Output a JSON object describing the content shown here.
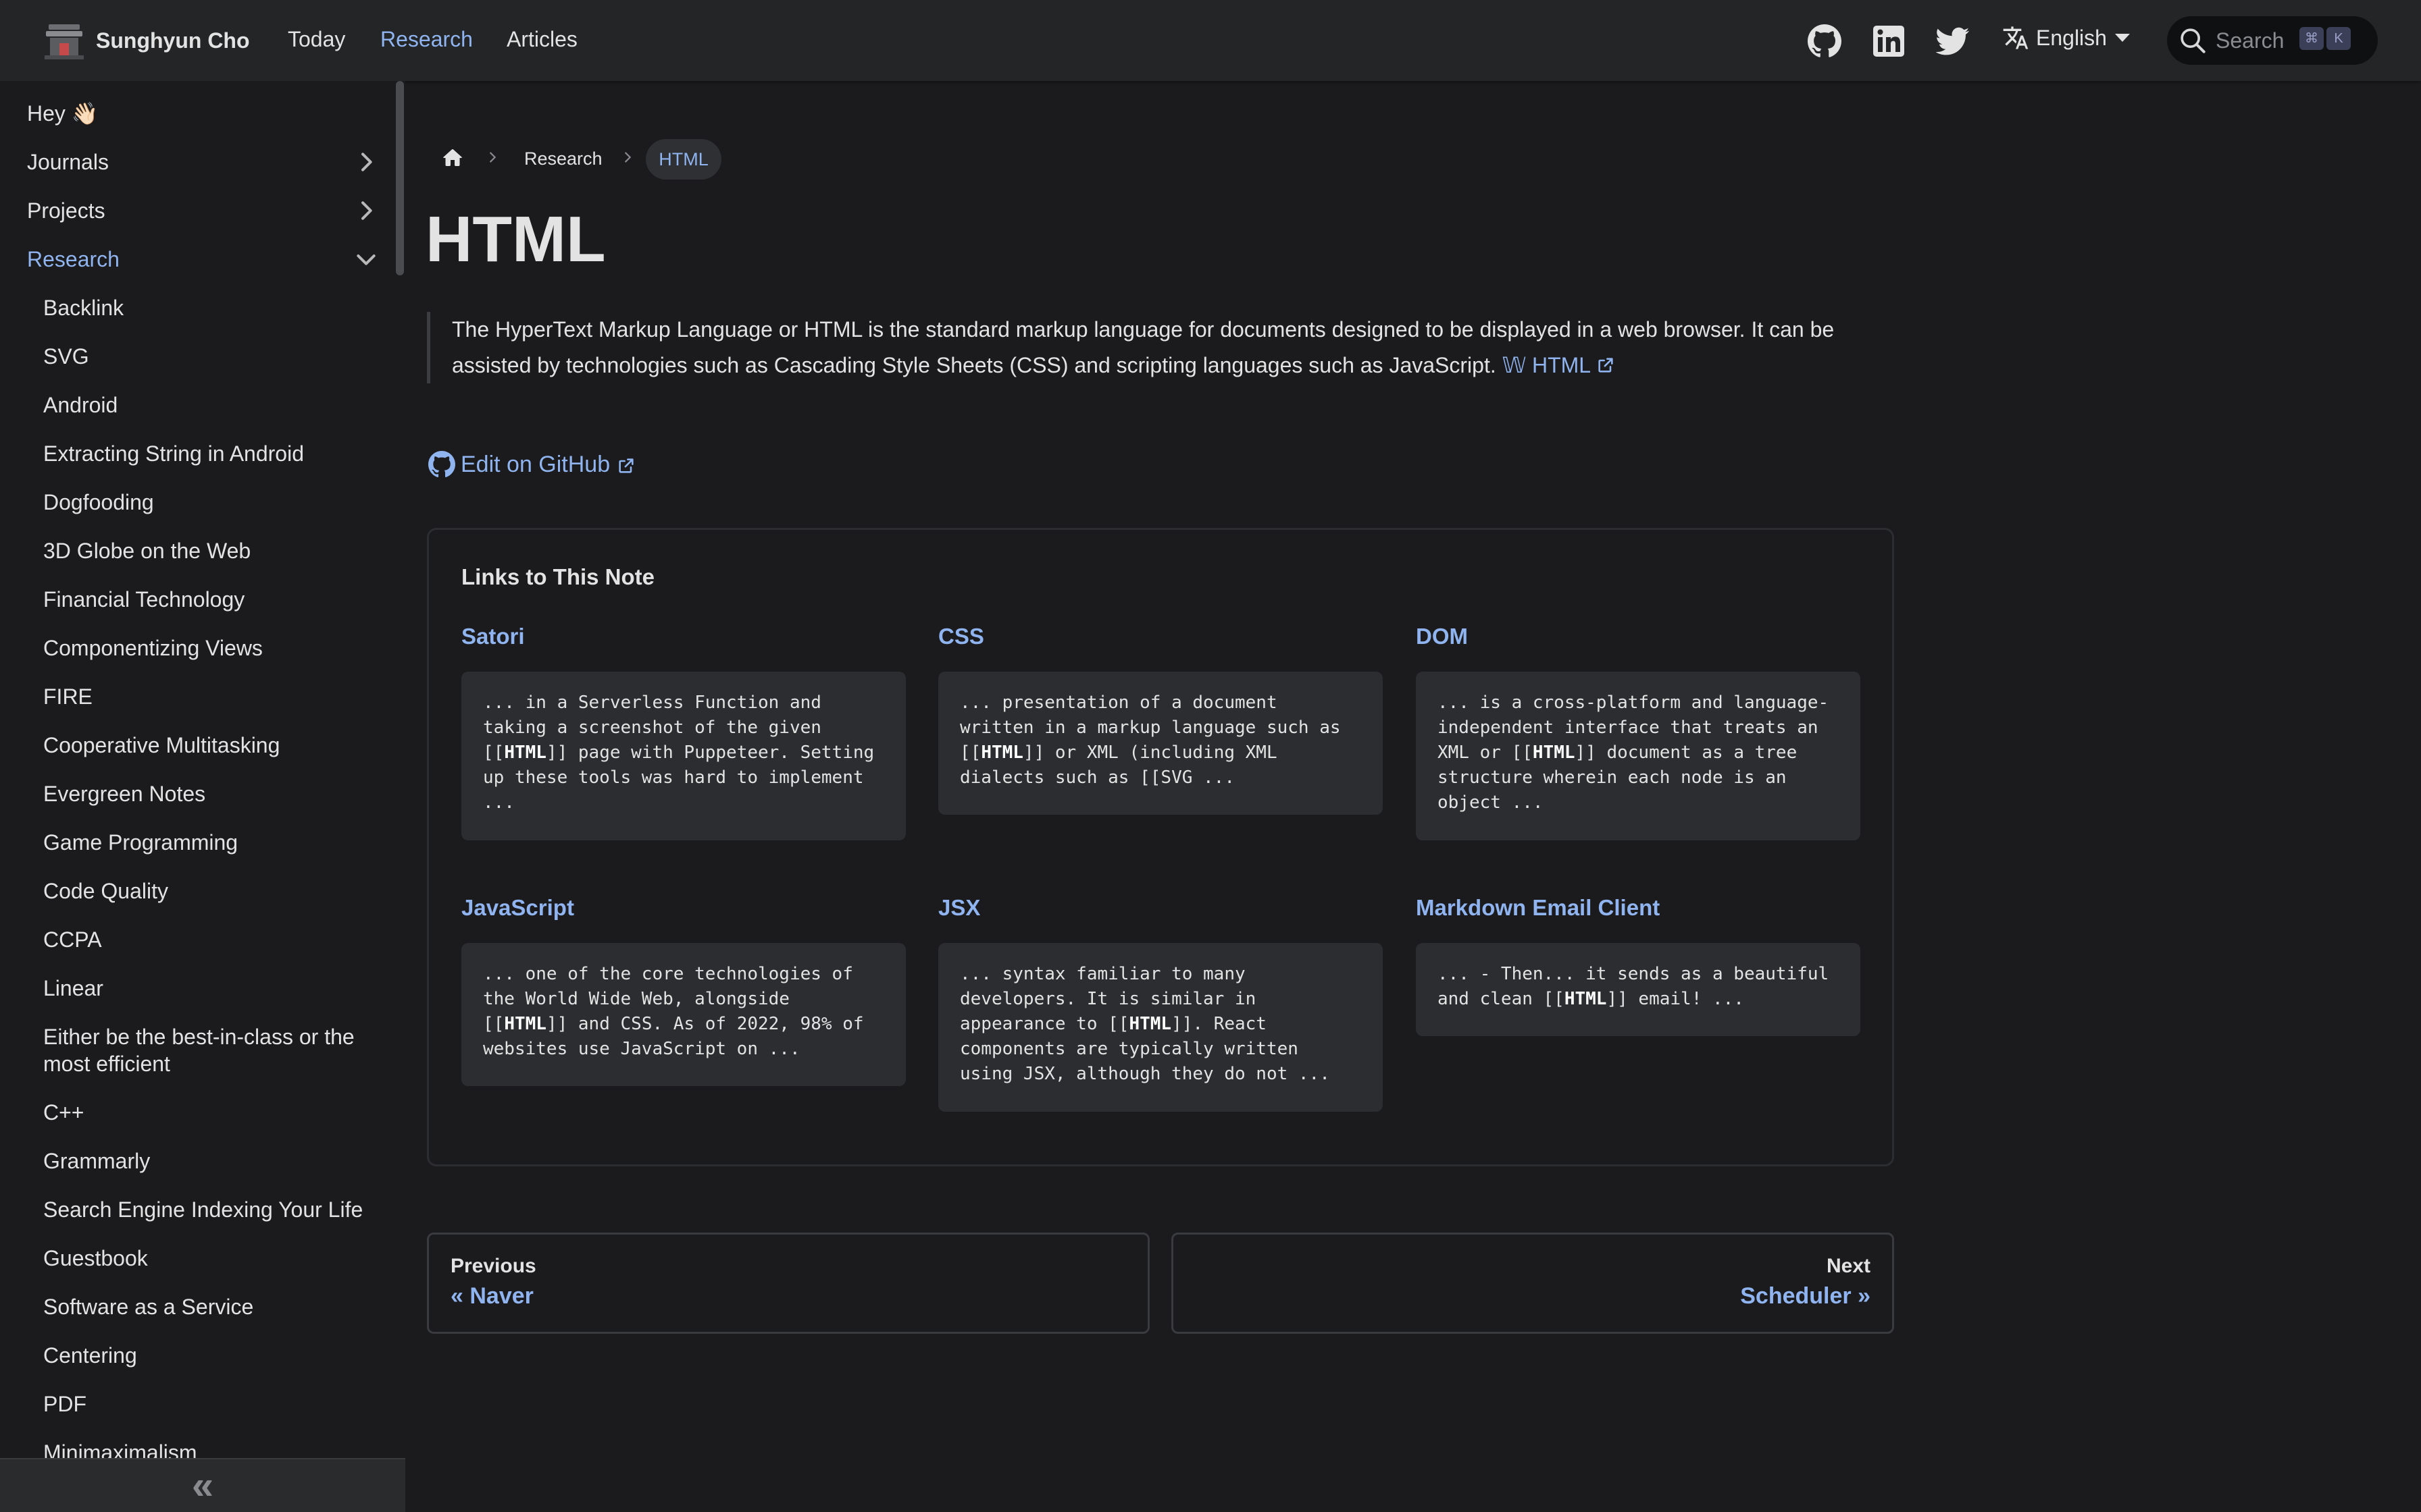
{
  "navbar": {
    "brand": "Sunghyun Cho",
    "links": [
      "Today",
      "Research",
      "Articles"
    ],
    "active_link": "Research",
    "icons": [
      "github-icon",
      "linkedin-icon",
      "twitter-icon"
    ],
    "language": "English",
    "search_placeholder": "Search",
    "search_keys": [
      "⌘",
      "K"
    ]
  },
  "sidebar": {
    "top_items": [
      {
        "label": "Hey 👋🏻",
        "chevron": "none"
      },
      {
        "label": "Journals",
        "chevron": "right"
      },
      {
        "label": "Projects",
        "chevron": "right"
      },
      {
        "label": "Research",
        "chevron": "down",
        "active": true
      }
    ],
    "research_items": [
      "Backlink",
      "SVG",
      "Android",
      "Extracting String in Android",
      "Dogfooding",
      "3D Globe on the Web",
      "Financial Technology",
      "Componentizing Views",
      "FIRE",
      "Cooperative Multitasking",
      "Evergreen Notes",
      "Game Programming",
      "Code Quality",
      "CCPA",
      "Linear",
      "Either be the best-in-class or the most efficient",
      "C++",
      "Grammarly",
      "Search Engine Indexing Your Life",
      "Guestbook",
      "Software as a Service",
      "Centering",
      "PDF",
      "Minimaximalism"
    ],
    "collapse_glyph": "«"
  },
  "breadcrumb": {
    "parent": "Research",
    "current": "HTML"
  },
  "page": {
    "title": "HTML",
    "quote": "The HyperText Markup Language or HTML is the standard markup language for documents designed to be displayed in a web browser. It can be assisted by technologies such as Cascading Style Sheets (CSS) and scripting languages such as JavaScript.",
    "wiki_link": "𝕎 HTML",
    "edit_link": "Edit on GitHub"
  },
  "backlinks": {
    "title": "Links to This Note",
    "cards": [
      {
        "title": "Satori",
        "excerpt": "... in a Serverless Function and taking a screenshot of the given [[HTML]] page with Puppeteer. Setting up these tools was hard to implement ..."
      },
      {
        "title": "CSS",
        "excerpt": "... presentation of a document written in a markup language such as [[HTML]] or XML (including XML dialects such as [[SVG ..."
      },
      {
        "title": "DOM",
        "excerpt": "... is a cross-platform and language-independent interface that treats an XML or [[HTML]] document as a tree structure wherein each node is an object ..."
      },
      {
        "title": "JavaScript",
        "excerpt": "... one of the core technologies of the World Wide Web, alongside [[HTML]] and CSS. As of 2022, 98% of websites use JavaScript on ..."
      },
      {
        "title": "JSX",
        "excerpt": "... syntax familiar to many developers. It is similar in appearance to [[HTML]]. React components are typically written using JSX, although they do not ..."
      },
      {
        "title": "Markdown Email Client",
        "excerpt": "... - Then... it sends as a beautiful and clean [[HTML]] email! ..."
      }
    ]
  },
  "pager": {
    "previous_sub": "Previous",
    "previous_label": "« Naver",
    "next_sub": "Next",
    "next_label": "Scheduler »"
  }
}
